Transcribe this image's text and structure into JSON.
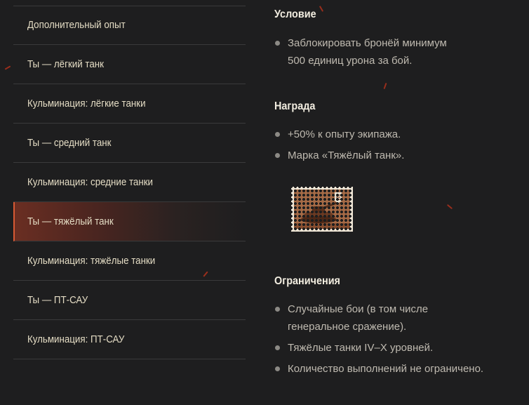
{
  "sidebar": {
    "items": [
      {
        "label": "Дополнительный опыт",
        "active": false
      },
      {
        "label": "Ты — лёгкий танк",
        "active": false
      },
      {
        "label": "Кульминация: лёгкие танки",
        "active": false
      },
      {
        "label": "Ты — средний танк",
        "active": false
      },
      {
        "label": "Кульминация: средние танки",
        "active": false
      },
      {
        "label": "Ты — тяжёлый танк",
        "active": true
      },
      {
        "label": "Кульминация: тяжёлые танки",
        "active": false
      },
      {
        "label": "Ты — ПТ-САУ",
        "active": false
      },
      {
        "label": "Кульминация: ПТ-САУ",
        "active": false
      }
    ]
  },
  "condition": {
    "title": "Условие",
    "items": [
      "Заблокировать бронёй минимум",
      "500 единиц урона за бой."
    ]
  },
  "reward": {
    "title": "Награда",
    "items": [
      "+50% к опыту экипажа.",
      "Марка «Тяжёлый танк»."
    ]
  },
  "restrictions": {
    "title": "Ограничения",
    "items": [
      "Случайные бои (в том числе",
      "генеральное сражение).",
      "Тяжёлые танки IV–X уровней.",
      "Количество выполнений не ограничено."
    ]
  },
  "colors": {
    "background": "#1e1e1f",
    "accent": "#d85a34",
    "divider": "#3a3a3b"
  }
}
